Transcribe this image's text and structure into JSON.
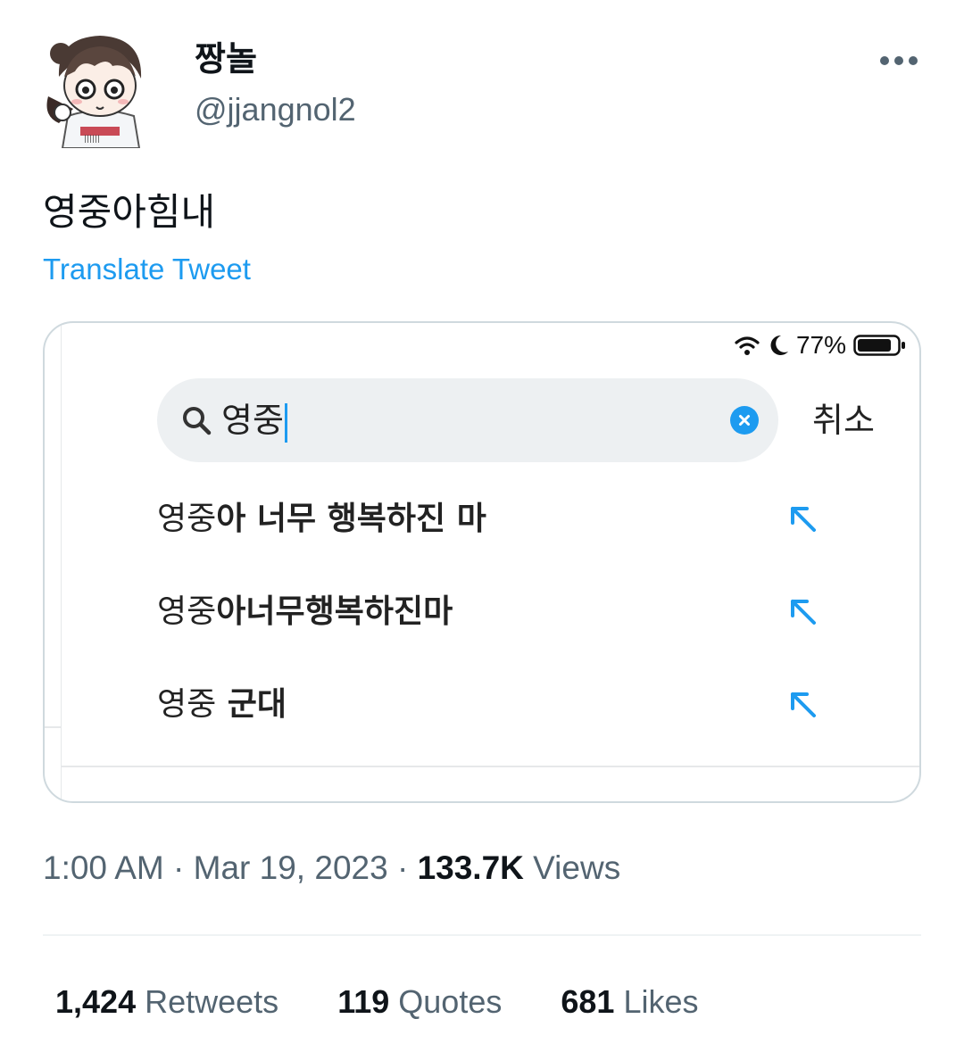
{
  "author": {
    "display_name": "짱놀",
    "handle": "@jjangnol2"
  },
  "tweet": {
    "text": "영중아힘내",
    "translate_label": "Translate Tweet"
  },
  "media": {
    "status_bar": {
      "battery": "77%"
    },
    "search": {
      "query": "영중",
      "cancel_label": "취소"
    },
    "suggestions": [
      {
        "typed": "영중",
        "rest": "아 너무 행복하진 마"
      },
      {
        "typed": "영중",
        "rest": "아너무행복하진마"
      },
      {
        "typed": "영중",
        "rest": " 군대"
      }
    ],
    "accent_color": "#1d9bf0"
  },
  "meta": {
    "time": "1:00 AM",
    "sep1": " · ",
    "date": "Mar 19, 2023",
    "sep2": " · ",
    "views_count": "133.7K",
    "views_label": " Views"
  },
  "stats": {
    "retweets_count": "1,424",
    "retweets_label": " Retweets",
    "quotes_count": "119",
    "quotes_label": " Quotes",
    "likes_count": "681",
    "likes_label": " Likes"
  }
}
